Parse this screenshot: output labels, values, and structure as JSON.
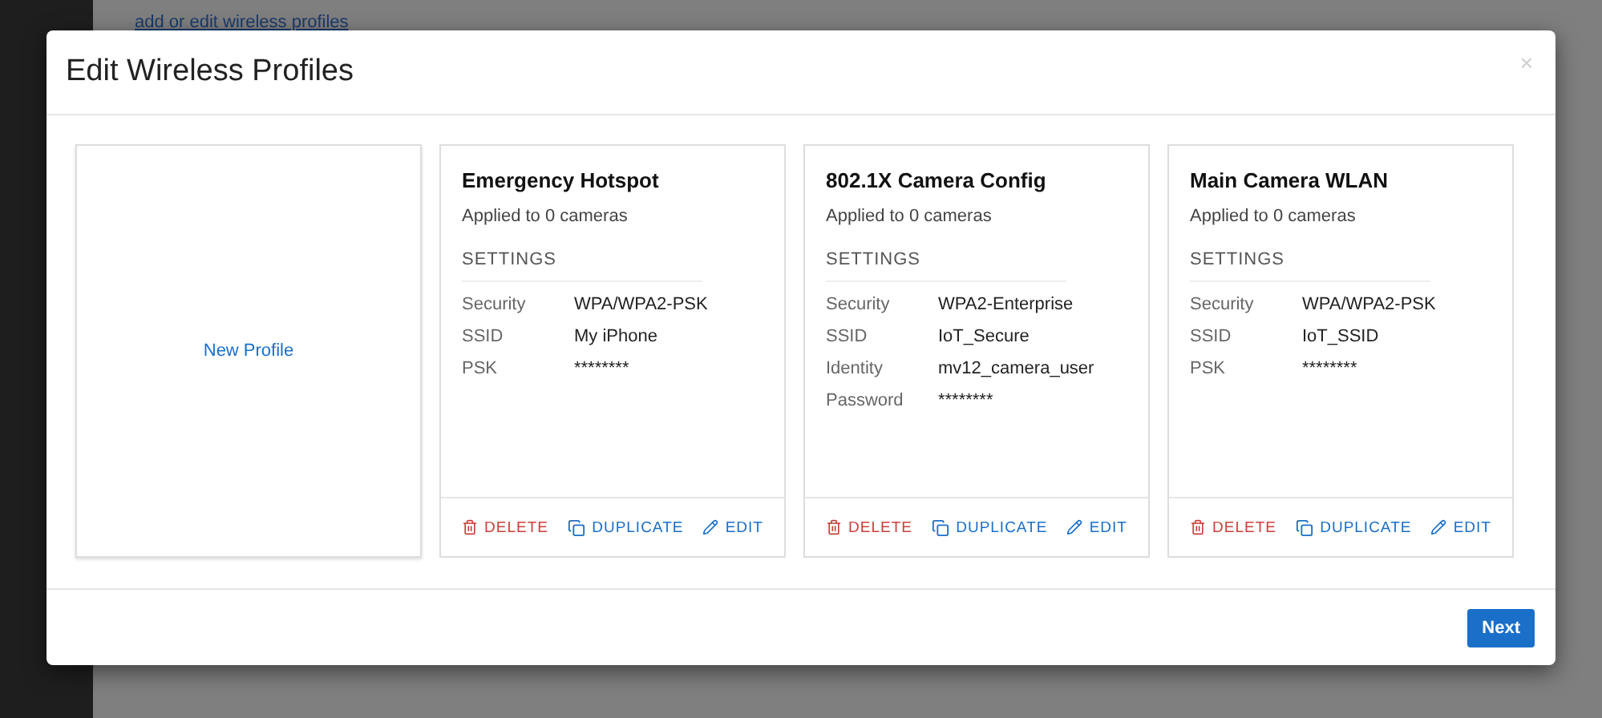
{
  "background": {
    "link": "add or edit wireless profiles"
  },
  "dialog": {
    "title": "Edit Wireless Profiles",
    "close": "×",
    "new_profile": "New Profile",
    "profiles": [
      {
        "name": "Emergency Hotspot",
        "applied": "Applied to 0 cameras",
        "section": "SETTINGS",
        "settings": [
          {
            "label": "Security",
            "value": "WPA/WPA2-PSK"
          },
          {
            "label": "SSID",
            "value": "My iPhone"
          },
          {
            "label": "PSK",
            "value": "********"
          }
        ],
        "actions": [
          {
            "kind": "delete",
            "label": "DELETE"
          },
          {
            "kind": "duplicate",
            "label": "DUPLICATE"
          },
          {
            "kind": "edit",
            "label": "EDIT"
          }
        ]
      },
      {
        "name": "802.1X Camera Config",
        "applied": "Applied to 0 cameras",
        "section": "SETTINGS",
        "settings": [
          {
            "label": "Security",
            "value": "WPA2-Enterprise"
          },
          {
            "label": "SSID",
            "value": "IoT_Secure"
          },
          {
            "label": "Identity",
            "value": "mv12_camera_user"
          },
          {
            "label": "Password",
            "value": "********"
          }
        ],
        "actions": [
          {
            "kind": "delete",
            "label": "DELETE"
          },
          {
            "kind": "duplicate",
            "label": "DUPLICATE"
          },
          {
            "kind": "edit",
            "label": "EDIT"
          }
        ]
      },
      {
        "name": "Main Camera WLAN",
        "applied": "Applied to 0 cameras",
        "section": "SETTINGS",
        "settings": [
          {
            "label": "Security",
            "value": "WPA/WPA2-PSK"
          },
          {
            "label": "SSID",
            "value": "IoT_SSID"
          },
          {
            "label": "PSK",
            "value": "********"
          }
        ],
        "actions": [
          {
            "kind": "delete",
            "label": "DELETE"
          },
          {
            "kind": "duplicate",
            "label": "DUPLICATE"
          },
          {
            "kind": "edit",
            "label": "EDIT"
          }
        ]
      }
    ],
    "next_button": "Next"
  }
}
